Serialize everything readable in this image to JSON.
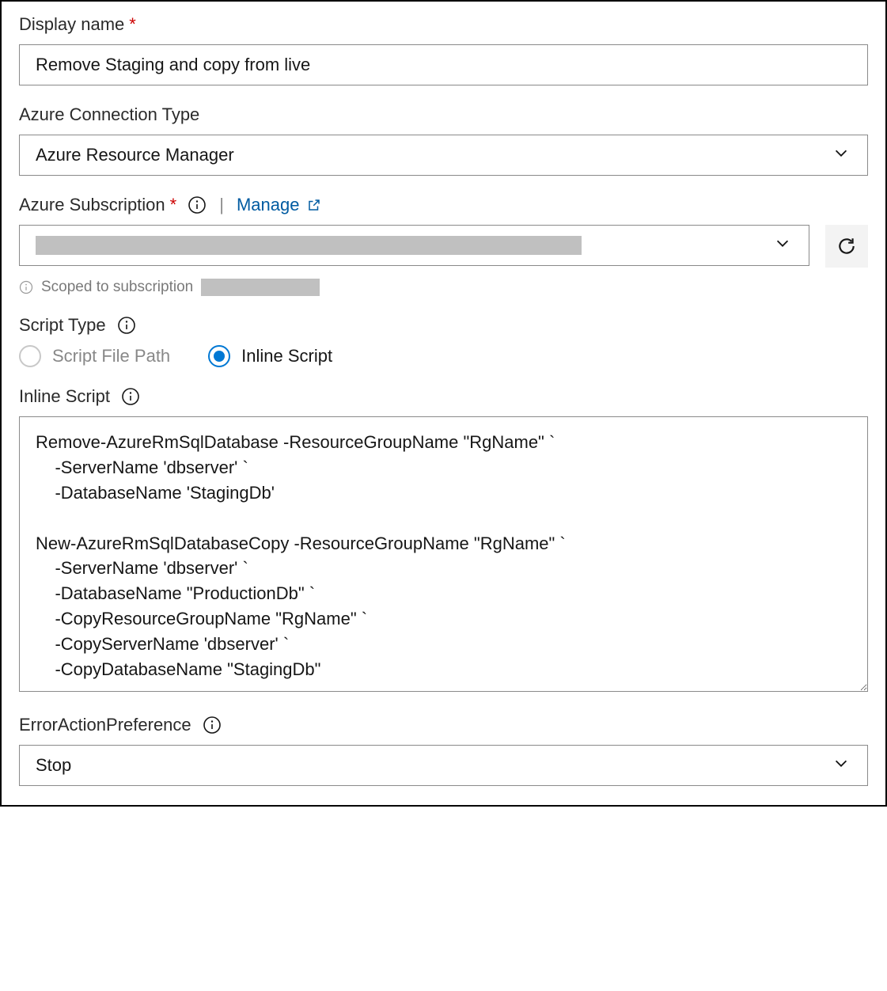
{
  "display_name": {
    "label": "Display name",
    "required_mark": "*",
    "value": "Remove Staging and copy from live"
  },
  "connection_type": {
    "label": "Azure Connection Type",
    "value": "Azure Resource Manager"
  },
  "subscription": {
    "label": "Azure Subscription",
    "required_mark": "*",
    "manage_text": "Manage",
    "scope_prefix": "Scoped to subscription"
  },
  "script_type": {
    "label": "Script Type",
    "options": {
      "file_path": "Script File Path",
      "inline": "Inline Script"
    },
    "selected": "inline"
  },
  "inline_script": {
    "label": "Inline Script",
    "value": "Remove-AzureRmSqlDatabase -ResourceGroupName \"RgName\" `\n    -ServerName 'dbserver' `\n    -DatabaseName 'StagingDb'\n\nNew-AzureRmSqlDatabaseCopy -ResourceGroupName \"RgName\" `\n    -ServerName 'dbserver' `\n    -DatabaseName \"ProductionDb\" `\n    -CopyResourceGroupName \"RgName\" `\n    -CopyServerName 'dbserver' `\n    -CopyDatabaseName \"StagingDb\""
  },
  "error_pref": {
    "label": "ErrorActionPreference",
    "value": "Stop"
  }
}
